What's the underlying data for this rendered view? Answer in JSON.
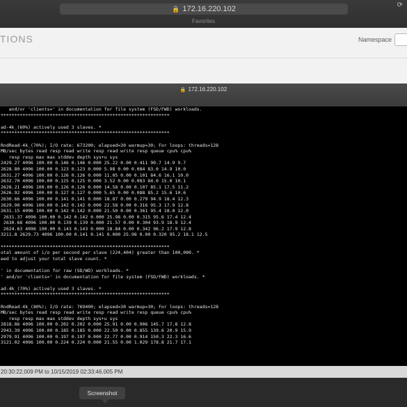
{
  "back_window": {
    "url": "172.16.220.102",
    "favorites": "Favorites",
    "page_title": "TIONS",
    "namespace_label": "Namespace"
  },
  "front_window": {
    "url": "172.16.220.102",
    "console_lines": [
      "   and/or 'clients=' in documentation for file system (FSD/FWD) workloads.",
      "**************************************************************",
      "",
      "ad-4k_(60%) actively used 3 slaves. *",
      "**************************************************************",
      "",
      "RndRead-4k_(70%); I/O rate: 673200; elapsed=30 warmup=30; For loops: threads=128",
      "MB/sec bytes read resp read write resp read write resp queue cpu% cpu%",
      "   resp resp max max stddev depth sys+u sys",
      "2429.27 4096 100.00 0.146 0.146 0.000 25.22 0.00 0.411 90.7 14.9 9.7",
      "2628.80 4096 100.00 0.123 0.123 0.000 5.98 0.00 0.084 83.0 14.9 10.0",
      "2631.27 4096 100.00 0.126 0.126 0.000 11.05 0.00 0.101 84.6 16.1 10.0",
      "2632.70 4096 100.00 0.125 0.125 0.000 3.52 0.00 0.083 84.0 15.0 10.1",
      "2628.21 4096 100.00 0.126 0.126 0.000 14.58 0.00 0.107 85.1 17.5 11.2",
      "2626.92 4096 100.00 0.127 0.127 0.000 5.65 0.00 0.088 85.2 15.6 10.6",
      "2630.66 4096 100.00 0.141 0.141 0.000 18.87 0.00 0.279 94.9 18.4 12.3",
      "2629.90 4096 100.00 0.142 0.142 0.000 22.58 0.00 0.316 95.3 17.9 12.8",
      "2631.15 4096 100.00 0.142 0.142 0.000 21.50 0.00 0.361 95.4 18.0 12.0",
      " 2631.37 4096 100.00 0.142 0.142 0.000 25.98 0.00 0.315 95.6 17.4 12.4",
      " 2630.68 4096 100.00 0.139 0.139 0.000 21.57 0.00 0.304 93.9 18.9 12.4",
      " 2624.63 4096 100.00 0.143 0.143 0.000 18.84 0.00 0.342 96.2 17.9 12.8",
      "3211.8 2629.73 4096 100.00 0.141 0.141 0.000 25.98 0.00 0.320 95.2 18.1 12.5",
      "",
      "**************************************************************",
      "otal amount of i/o per second per slave (224,404) greater than 100,000. *",
      "eed to adjust your total slave count. *",
      "",
      "' in documentation for raw (SD/WD) workloads. *",
      "' and/or 'clients=' in documentation for file system (FSD/FWD) workloads. *",
      "",
      "ad-4k_(70%) actively used 3 slaves. *",
      "**************************************************************",
      "",
      "RndRead-4k_(80%); I/O rate: 769400; elapsed=30 warmup=30; For loops: threads=128",
      "MB/sec bytes read resp read write resp read write resp queue cpu% cpu%",
      "   resp resp max max stddev depth sys+u sys",
      "2818.86 4096 100.00 0.202 0.202 0.000 25.91 0.00 0.906 145.7 17.8 12.8",
      "2943.39 4096 100.00 0.185 0.185 0.000 22.50 0.00 0.855 139.6 20.9 15.9",
      "2979.91 4096 100.00 0.197 0.197 0.000 22.77 0.00 0.914 150.3 22.3 16.6",
      "3121.02 4096 100.00 0.224 0.224 0.000 21.55 0.00 1.029 178.8 21.7 17.1"
    ],
    "footer_text": "20:30:22.009 PM to 10/15/2019 02:33:46.005 PM"
  },
  "tooltip": "Screenshot",
  "icons": {
    "lock": "lock-icon",
    "reload": "reload-icon"
  },
  "colors": {
    "console_bg": "#000000",
    "console_fg": "#e6e6e6",
    "footer_bg": "#d9d9d9"
  }
}
